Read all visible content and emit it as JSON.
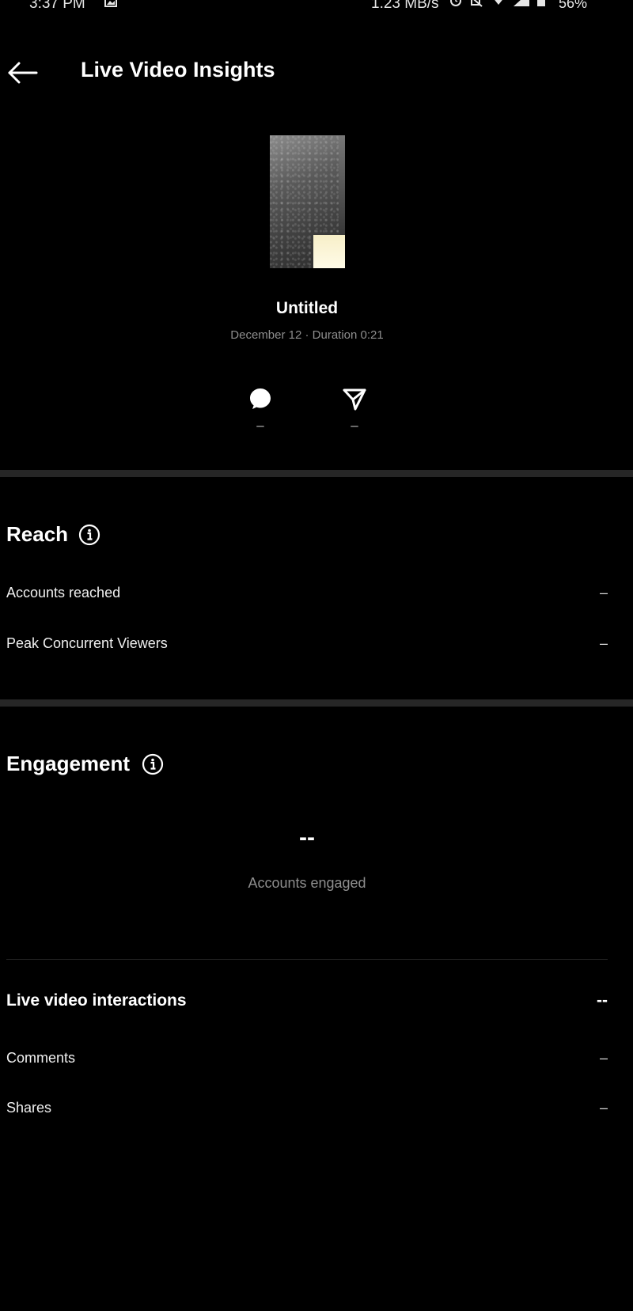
{
  "status_bar": {
    "time": "3:37 PM",
    "speed": "1.23 MB/s",
    "battery": "56%",
    "icons": [
      "gallery-icon",
      "alarm-icon",
      "mute-icon",
      "wifi-icon",
      "signal-icon",
      "battery-icon"
    ]
  },
  "header": {
    "title": "Live Video Insights"
  },
  "video": {
    "title": "Untitled",
    "subtitle": "December 12 · Duration 0:21"
  },
  "stats": {
    "comments_value": "–",
    "shares_value": "–"
  },
  "reach": {
    "title": "Reach",
    "rows": [
      {
        "label": "Accounts reached",
        "value": "–"
      },
      {
        "label": "Peak Concurrent Viewers",
        "value": "–"
      }
    ]
  },
  "engagement": {
    "title": "Engagement",
    "accounts_engaged_value": "--",
    "accounts_engaged_label": "Accounts engaged",
    "interactions_title": "Live video interactions",
    "interactions_value": "--",
    "rows": [
      {
        "label": "Comments",
        "value": "–"
      },
      {
        "label": "Shares",
        "value": "–"
      }
    ]
  },
  "colors": {
    "background": "#000000",
    "divider": "#262626",
    "muted_text": "#8e8e8e"
  }
}
